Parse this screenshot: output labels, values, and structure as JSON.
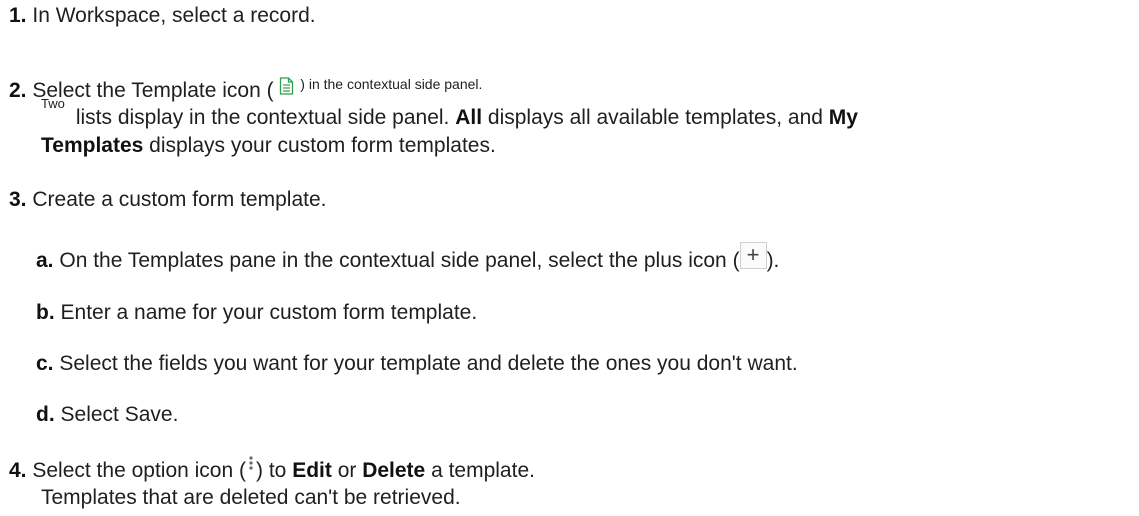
{
  "steps": [
    {
      "num": "1.",
      "text": "In Workspace, select a record."
    },
    {
      "num": "2.",
      "text_before": "Select the Template icon (",
      "text_after": ") in the contextual side panel."
    },
    {
      "num": "3.",
      "text": "Create a custom form template."
    },
    {
      "num": "4.",
      "text_before": "Select the option icon (",
      "text_mid": ") to ",
      "edit": "Edit",
      "or": " or ",
      "delete": "Delete",
      "text_after": " a template."
    }
  ],
  "step2_note": {
    "two": "Two",
    "part1": " lists display in the contextual side panel. ",
    "all": "All",
    "part2": " displays all available templates, and ",
    "my": "My",
    "templates": "Templates",
    "part3": " displays your custom form templates."
  },
  "substeps": [
    {
      "letter": "a.",
      "text_before": "On the Templates pane in the contextual side panel, select the plus icon (",
      "text_after": ")."
    },
    {
      "letter": "b.",
      "text": "Enter a name for your custom form template."
    },
    {
      "letter": "c.",
      "text": "Select the fields you want for your template and delete the ones you don't want."
    },
    {
      "letter": "d.",
      "text": "Select Save."
    }
  ],
  "step4_note": "Templates that are deleted can't be retrieved.",
  "icons": {
    "template": "document-icon",
    "plus": "plus-icon",
    "option": "vertical-ellipsis-icon"
  },
  "colors": {
    "template_icon": "#2e9e4f",
    "option_icon": "#666666"
  }
}
